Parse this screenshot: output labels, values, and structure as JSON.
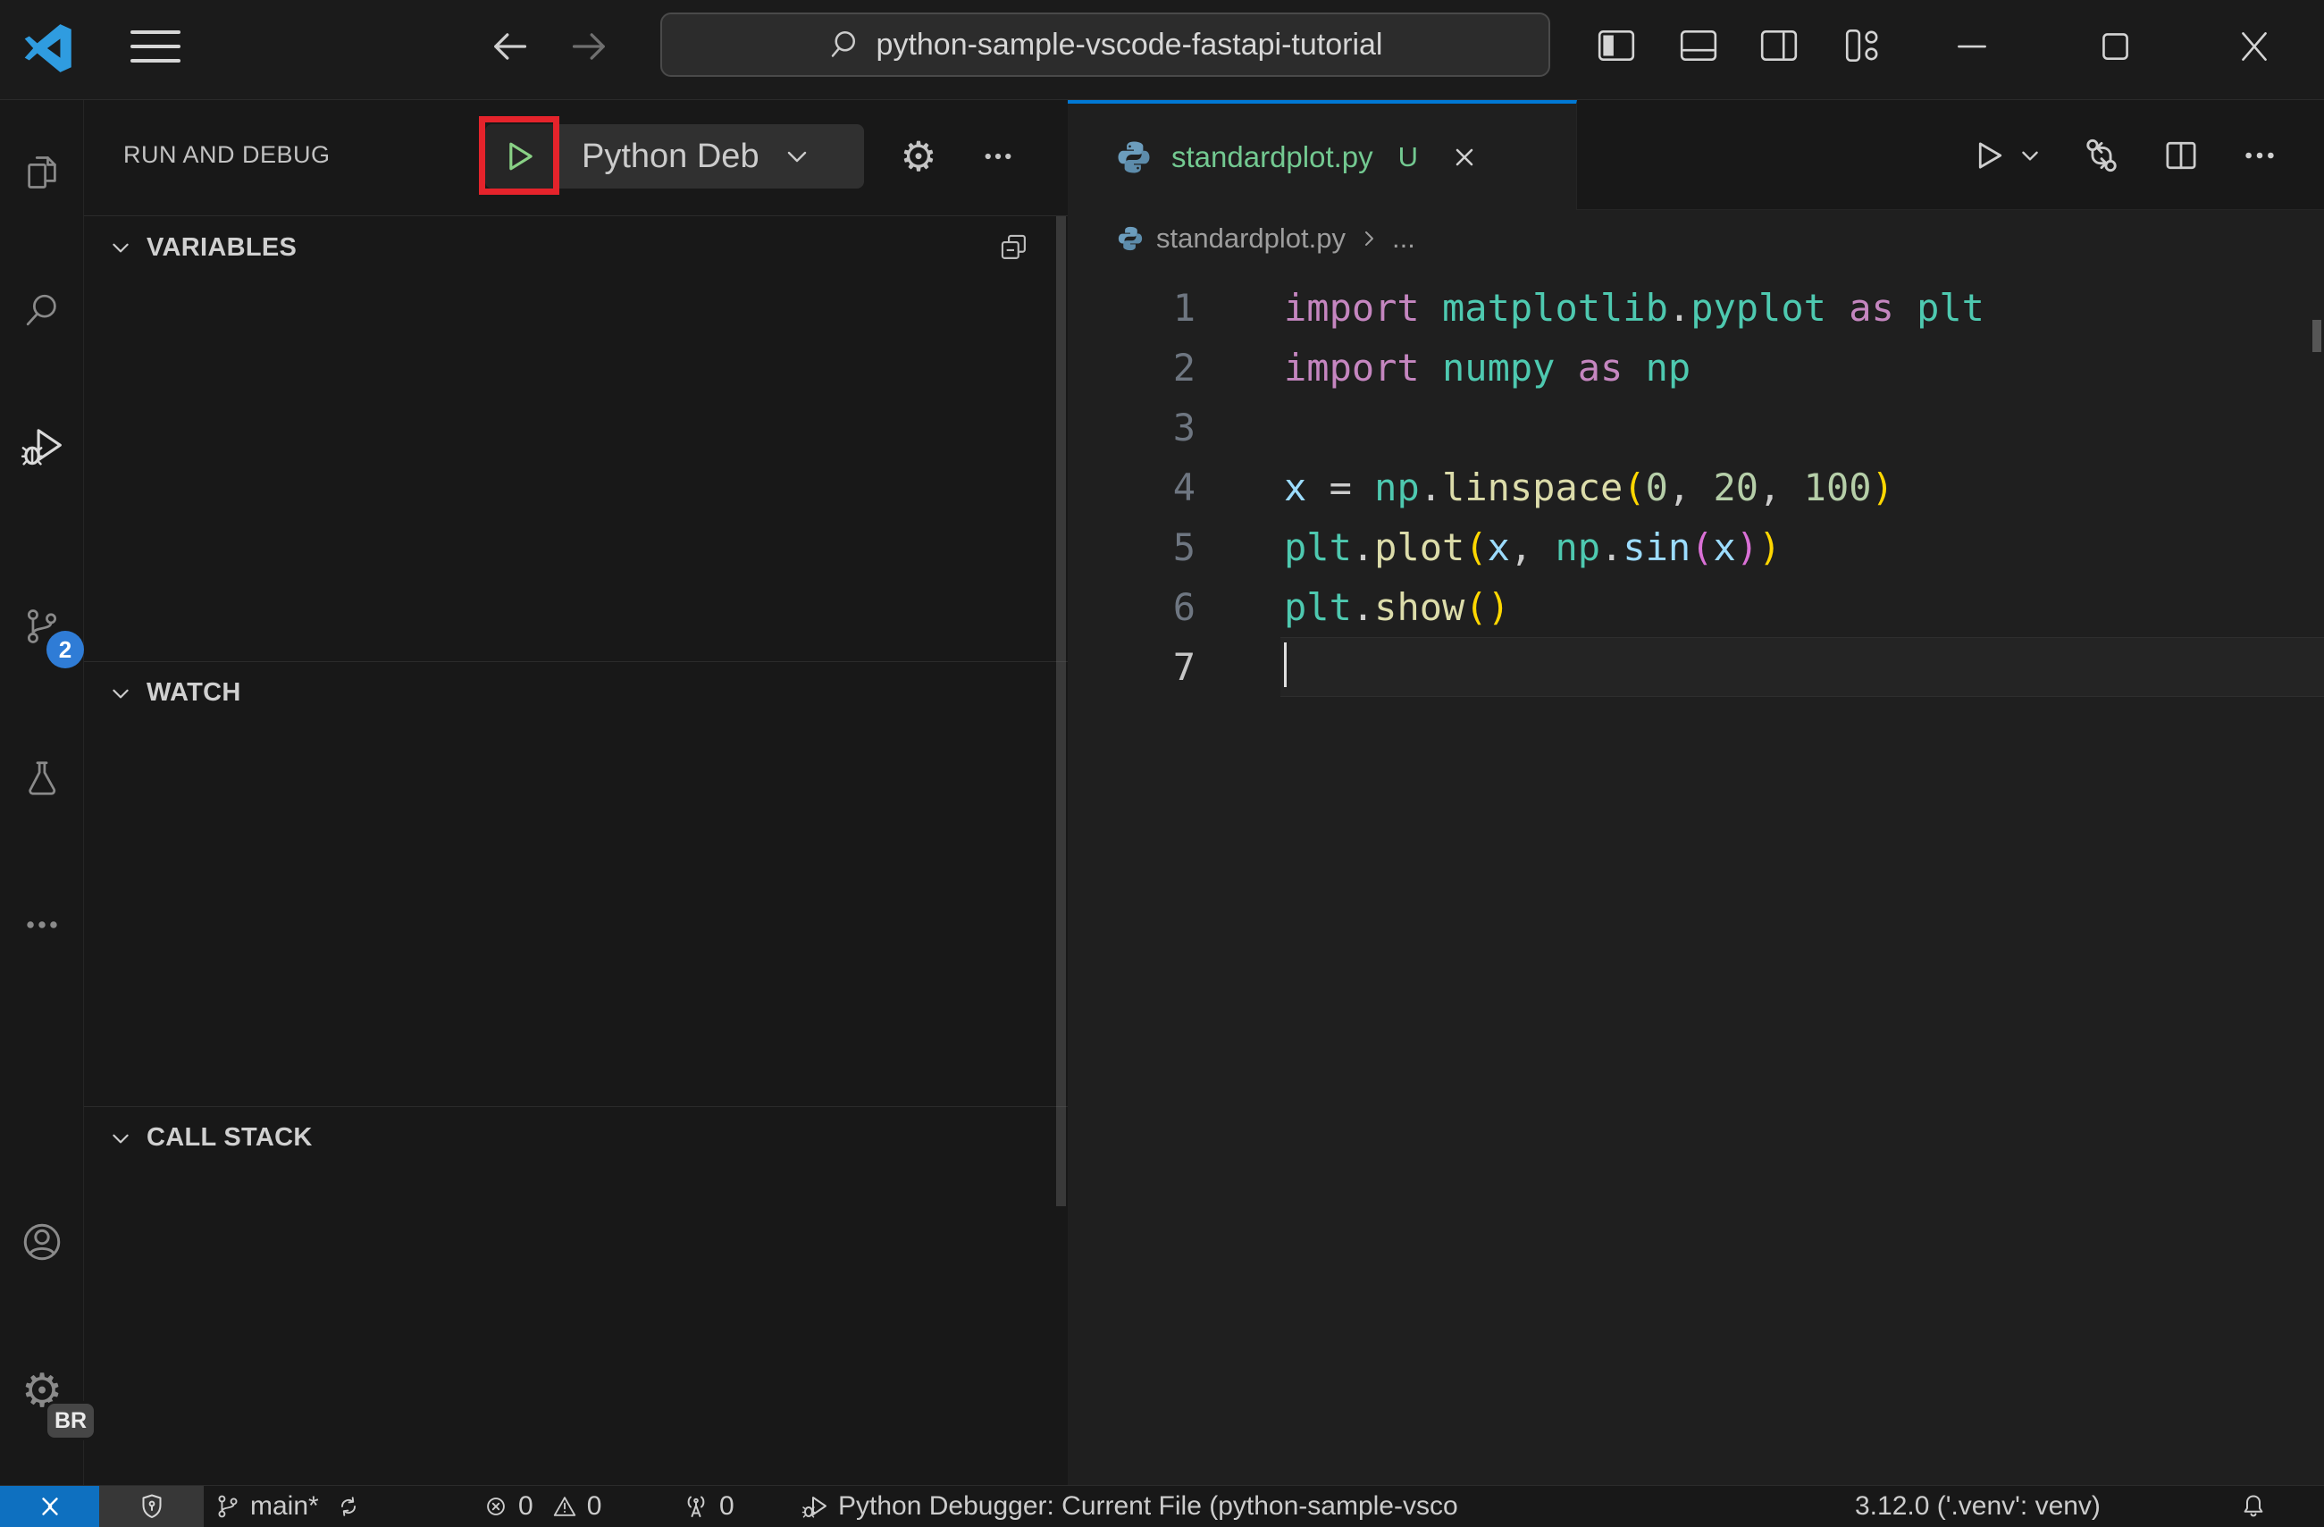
{
  "colors": {
    "accent": "#0078d4",
    "untracked_green": "#73c991",
    "annotation_red": "#e5232b",
    "play_green": "#89d185",
    "remote_blue": "#0e70c0"
  },
  "titlebar": {
    "search_value": "python-sample-vscode-fastapi-tutorial"
  },
  "activity_bar": {
    "scm_badge": "2",
    "profile_badge": "BR"
  },
  "sidebar": {
    "title": "RUN AND DEBUG",
    "launch_config": "Python Deb",
    "sections": {
      "variables": "VARIABLES",
      "watch": "WATCH",
      "call_stack": "CALL STACK"
    }
  },
  "editor": {
    "tab": {
      "label": "standardplot.py",
      "modified_indicator": "U"
    },
    "breadcrumb": {
      "file": "standardplot.py",
      "symbol": "..."
    },
    "code": {
      "token_colors": {
        "kw": "#C586C0",
        "mod": "#4EC9B0",
        "fn": "#DCDCAA",
        "var": "#9CDCFE",
        "num": "#B5CEA8",
        "op": "#CCCCCC",
        "b1": "#FFD700",
        "b2": "#DA70D6"
      },
      "lines": [
        {
          "num": "1",
          "tokens": [
            [
              "kw",
              "import"
            ],
            [
              "op",
              " "
            ],
            [
              "mod",
              "matplotlib"
            ],
            [
              "op",
              "."
            ],
            [
              "mod",
              "pyplot"
            ],
            [
              "op",
              " "
            ],
            [
              "kw",
              "as"
            ],
            [
              "op",
              " "
            ],
            [
              "mod",
              "plt"
            ]
          ]
        },
        {
          "num": "2",
          "tokens": [
            [
              "kw",
              "import"
            ],
            [
              "op",
              " "
            ],
            [
              "mod",
              "numpy"
            ],
            [
              "op",
              " "
            ],
            [
              "kw",
              "as"
            ],
            [
              "op",
              " "
            ],
            [
              "mod",
              "np"
            ]
          ]
        },
        {
          "num": "3",
          "tokens": []
        },
        {
          "num": "4",
          "tokens": [
            [
              "var",
              "x"
            ],
            [
              "op",
              " = "
            ],
            [
              "mod",
              "np"
            ],
            [
              "op",
              "."
            ],
            [
              "fn",
              "linspace"
            ],
            [
              "b1",
              "("
            ],
            [
              "num",
              "0"
            ],
            [
              "op",
              ", "
            ],
            [
              "num",
              "20"
            ],
            [
              "op",
              ", "
            ],
            [
              "num",
              "100"
            ],
            [
              "b1",
              ")"
            ]
          ]
        },
        {
          "num": "5",
          "tokens": [
            [
              "mod",
              "plt"
            ],
            [
              "op",
              "."
            ],
            [
              "fn",
              "plot"
            ],
            [
              "b1",
              "("
            ],
            [
              "var",
              "x"
            ],
            [
              "op",
              ", "
            ],
            [
              "mod",
              "np"
            ],
            [
              "op",
              "."
            ],
            [
              "var",
              "sin"
            ],
            [
              "b2",
              "("
            ],
            [
              "var",
              "x"
            ],
            [
              "b2",
              ")"
            ],
            [
              "b1",
              ")"
            ]
          ]
        },
        {
          "num": "6",
          "tokens": [
            [
              "mod",
              "plt"
            ],
            [
              "op",
              "."
            ],
            [
              "fn",
              "show"
            ],
            [
              "b1",
              "("
            ],
            [
              "b1",
              ")"
            ]
          ]
        },
        {
          "num": "7",
          "tokens": [],
          "cursor": true,
          "active": true
        }
      ]
    }
  },
  "status_bar": {
    "branch": "main*",
    "errors": "0",
    "warnings": "0",
    "ports": "0",
    "debug_status": "Python Debugger: Current File (python-sample-vsco",
    "interpreter": "3.12.0 ('.venv': venv)"
  }
}
